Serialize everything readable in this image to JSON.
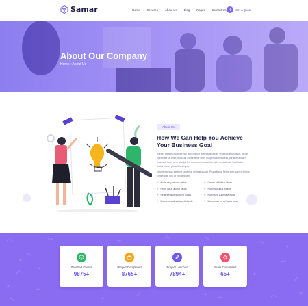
{
  "brand": {
    "name": "Samar",
    "accent": "#6b5ae8",
    "hero_overlay": "#7b63ef",
    "stats_bg": "#8a6cf2"
  },
  "nav": {
    "items": [
      "Home",
      "Services",
      "About Us",
      "Blog",
      "Pages",
      "Contact Us"
    ],
    "cta_label": "Get A Quote",
    "cta_icon": "arrow-right-icon"
  },
  "hero": {
    "title": "About Our Company",
    "breadcrumb": {
      "home": "Home",
      "separator": "›",
      "current": "About Us"
    }
  },
  "about": {
    "tag": "About Us",
    "title": "How  We Can Help You Achieve Your Business  Goal",
    "paragraphs": [
      "Integer pretium molestie nisl, non blandit lectus suscipit in. Vivamus tellus diam, iaculis eget nulla sit amet, tincidunt consectetur sem. Suspendisse laoreet, purus et aliquet tincidunt, tortor sem suscipit leo ante sed consectetur ante eros at nisl. Vestibulum luctus non et phasellus tempor.",
      "Mauris egestas eleifend sapien at mi malesuada. Phasellus at Fetus eget sapien finibus consequat, non at rhoncus sem."
    ],
    "features": [
      "Nulla diu posuere veltas",
      "Donec et finibus libero",
      "Proin lacus auctor lacus",
      "Nunc faucibus neque",
      "Pellentesque dui sem mollis",
      "Nunc sed vulputate nulla",
      "Donec sodales aliquet blandit",
      "Maecenas ex vehicula urna"
    ]
  },
  "stats": [
    {
      "label": "Satisfied Clients",
      "value": "9875+",
      "icon": "happy-face-icon",
      "color": "#2fb56a"
    },
    {
      "label": "Project Completed",
      "value": "8765+",
      "icon": "briefcase-icon",
      "color": "#f7a416"
    },
    {
      "label": "Project Lunched",
      "value": "7894+",
      "icon": "rocket-icon",
      "color": "#6b5ae8"
    },
    {
      "label": "Years Completed",
      "value": "65+",
      "icon": "gear-star-icon",
      "color": "#f1536e"
    }
  ]
}
